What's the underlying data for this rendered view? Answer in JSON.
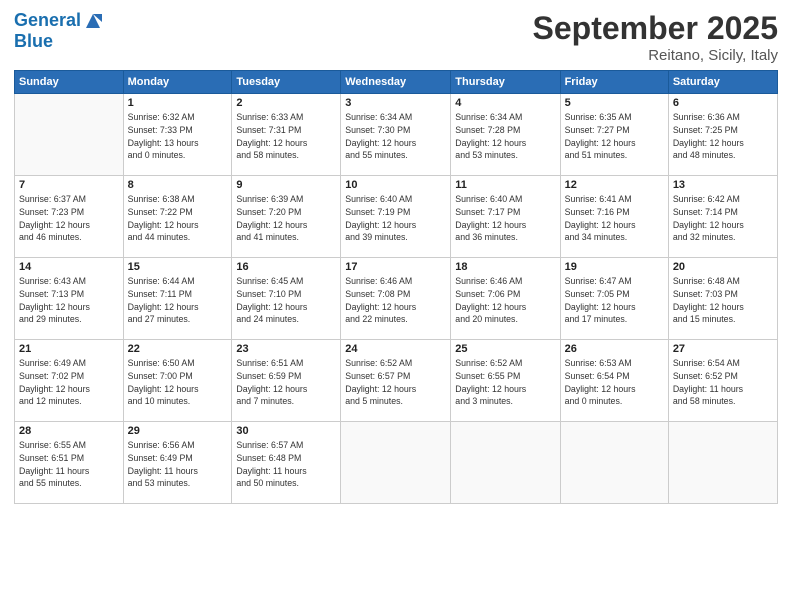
{
  "header": {
    "logo_line1": "General",
    "logo_line2": "Blue",
    "month": "September 2025",
    "location": "Reitano, Sicily, Italy"
  },
  "days_of_week": [
    "Sunday",
    "Monday",
    "Tuesday",
    "Wednesday",
    "Thursday",
    "Friday",
    "Saturday"
  ],
  "weeks": [
    [
      {
        "day": "",
        "info": ""
      },
      {
        "day": "1",
        "info": "Sunrise: 6:32 AM\nSunset: 7:33 PM\nDaylight: 13 hours\nand 0 minutes."
      },
      {
        "day": "2",
        "info": "Sunrise: 6:33 AM\nSunset: 7:31 PM\nDaylight: 12 hours\nand 58 minutes."
      },
      {
        "day": "3",
        "info": "Sunrise: 6:34 AM\nSunset: 7:30 PM\nDaylight: 12 hours\nand 55 minutes."
      },
      {
        "day": "4",
        "info": "Sunrise: 6:34 AM\nSunset: 7:28 PM\nDaylight: 12 hours\nand 53 minutes."
      },
      {
        "day": "5",
        "info": "Sunrise: 6:35 AM\nSunset: 7:27 PM\nDaylight: 12 hours\nand 51 minutes."
      },
      {
        "day": "6",
        "info": "Sunrise: 6:36 AM\nSunset: 7:25 PM\nDaylight: 12 hours\nand 48 minutes."
      }
    ],
    [
      {
        "day": "7",
        "info": "Sunrise: 6:37 AM\nSunset: 7:23 PM\nDaylight: 12 hours\nand 46 minutes."
      },
      {
        "day": "8",
        "info": "Sunrise: 6:38 AM\nSunset: 7:22 PM\nDaylight: 12 hours\nand 44 minutes."
      },
      {
        "day": "9",
        "info": "Sunrise: 6:39 AM\nSunset: 7:20 PM\nDaylight: 12 hours\nand 41 minutes."
      },
      {
        "day": "10",
        "info": "Sunrise: 6:40 AM\nSunset: 7:19 PM\nDaylight: 12 hours\nand 39 minutes."
      },
      {
        "day": "11",
        "info": "Sunrise: 6:40 AM\nSunset: 7:17 PM\nDaylight: 12 hours\nand 36 minutes."
      },
      {
        "day": "12",
        "info": "Sunrise: 6:41 AM\nSunset: 7:16 PM\nDaylight: 12 hours\nand 34 minutes."
      },
      {
        "day": "13",
        "info": "Sunrise: 6:42 AM\nSunset: 7:14 PM\nDaylight: 12 hours\nand 32 minutes."
      }
    ],
    [
      {
        "day": "14",
        "info": "Sunrise: 6:43 AM\nSunset: 7:13 PM\nDaylight: 12 hours\nand 29 minutes."
      },
      {
        "day": "15",
        "info": "Sunrise: 6:44 AM\nSunset: 7:11 PM\nDaylight: 12 hours\nand 27 minutes."
      },
      {
        "day": "16",
        "info": "Sunrise: 6:45 AM\nSunset: 7:10 PM\nDaylight: 12 hours\nand 24 minutes."
      },
      {
        "day": "17",
        "info": "Sunrise: 6:46 AM\nSunset: 7:08 PM\nDaylight: 12 hours\nand 22 minutes."
      },
      {
        "day": "18",
        "info": "Sunrise: 6:46 AM\nSunset: 7:06 PM\nDaylight: 12 hours\nand 20 minutes."
      },
      {
        "day": "19",
        "info": "Sunrise: 6:47 AM\nSunset: 7:05 PM\nDaylight: 12 hours\nand 17 minutes."
      },
      {
        "day": "20",
        "info": "Sunrise: 6:48 AM\nSunset: 7:03 PM\nDaylight: 12 hours\nand 15 minutes."
      }
    ],
    [
      {
        "day": "21",
        "info": "Sunrise: 6:49 AM\nSunset: 7:02 PM\nDaylight: 12 hours\nand 12 minutes."
      },
      {
        "day": "22",
        "info": "Sunrise: 6:50 AM\nSunset: 7:00 PM\nDaylight: 12 hours\nand 10 minutes."
      },
      {
        "day": "23",
        "info": "Sunrise: 6:51 AM\nSunset: 6:59 PM\nDaylight: 12 hours\nand 7 minutes."
      },
      {
        "day": "24",
        "info": "Sunrise: 6:52 AM\nSunset: 6:57 PM\nDaylight: 12 hours\nand 5 minutes."
      },
      {
        "day": "25",
        "info": "Sunrise: 6:52 AM\nSunset: 6:55 PM\nDaylight: 12 hours\nand 3 minutes."
      },
      {
        "day": "26",
        "info": "Sunrise: 6:53 AM\nSunset: 6:54 PM\nDaylight: 12 hours\nand 0 minutes."
      },
      {
        "day": "27",
        "info": "Sunrise: 6:54 AM\nSunset: 6:52 PM\nDaylight: 11 hours\nand 58 minutes."
      }
    ],
    [
      {
        "day": "28",
        "info": "Sunrise: 6:55 AM\nSunset: 6:51 PM\nDaylight: 11 hours\nand 55 minutes."
      },
      {
        "day": "29",
        "info": "Sunrise: 6:56 AM\nSunset: 6:49 PM\nDaylight: 11 hours\nand 53 minutes."
      },
      {
        "day": "30",
        "info": "Sunrise: 6:57 AM\nSunset: 6:48 PM\nDaylight: 11 hours\nand 50 minutes."
      },
      {
        "day": "",
        "info": ""
      },
      {
        "day": "",
        "info": ""
      },
      {
        "day": "",
        "info": ""
      },
      {
        "day": "",
        "info": ""
      }
    ]
  ]
}
